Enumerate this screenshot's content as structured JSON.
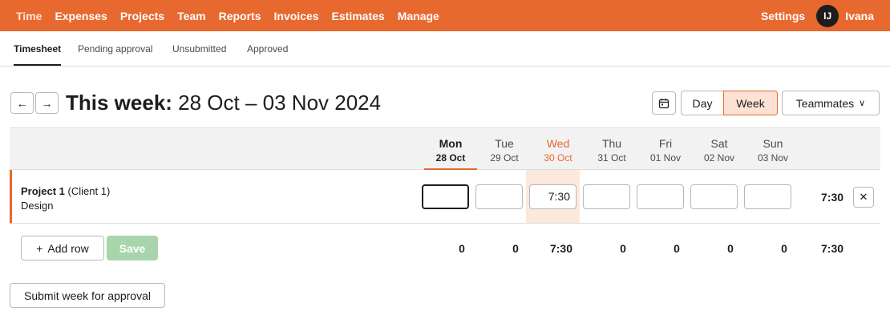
{
  "nav": {
    "items": [
      "Time",
      "Expenses",
      "Projects",
      "Team",
      "Reports",
      "Invoices",
      "Estimates",
      "Manage"
    ],
    "settings": "Settings",
    "user_initials": "IJ",
    "user_name": "Ivana"
  },
  "subnav": [
    "Timesheet",
    "Pending approval",
    "Unsubmitted",
    "Approved"
  ],
  "header": {
    "title_bold": "This week:",
    "title_range": " 28 Oct – 03 Nov 2024",
    "prev_icon": "arrow-left-icon",
    "next_icon": "arrow-right-icon",
    "day_label": "Day",
    "week_label": "Week",
    "teammates_label": "Teammates"
  },
  "days": [
    {
      "name": "Mon",
      "date": "28 Oct"
    },
    {
      "name": "Tue",
      "date": "29 Oct"
    },
    {
      "name": "Wed",
      "date": "30 Oct"
    },
    {
      "name": "Thu",
      "date": "31 Oct"
    },
    {
      "name": "Fri",
      "date": "01 Nov"
    },
    {
      "name": "Sat",
      "date": "02 Nov"
    },
    {
      "name": "Sun",
      "date": "03 Nov"
    }
  ],
  "row": {
    "project": "Project 1",
    "client": " (Client 1)",
    "task": "Design",
    "values": [
      "",
      "",
      "7:30",
      "",
      "",
      "",
      ""
    ],
    "total": "7:30"
  },
  "footer": {
    "add_row": "Add row",
    "save": "Save",
    "totals": [
      "0",
      "0",
      "7:30",
      "0",
      "0",
      "0",
      "0"
    ],
    "grand_total": "7:30",
    "submit": "Submit week for approval"
  },
  "colors": {
    "accent": "#e8692f",
    "save_disabled": "#a9d5ac"
  }
}
